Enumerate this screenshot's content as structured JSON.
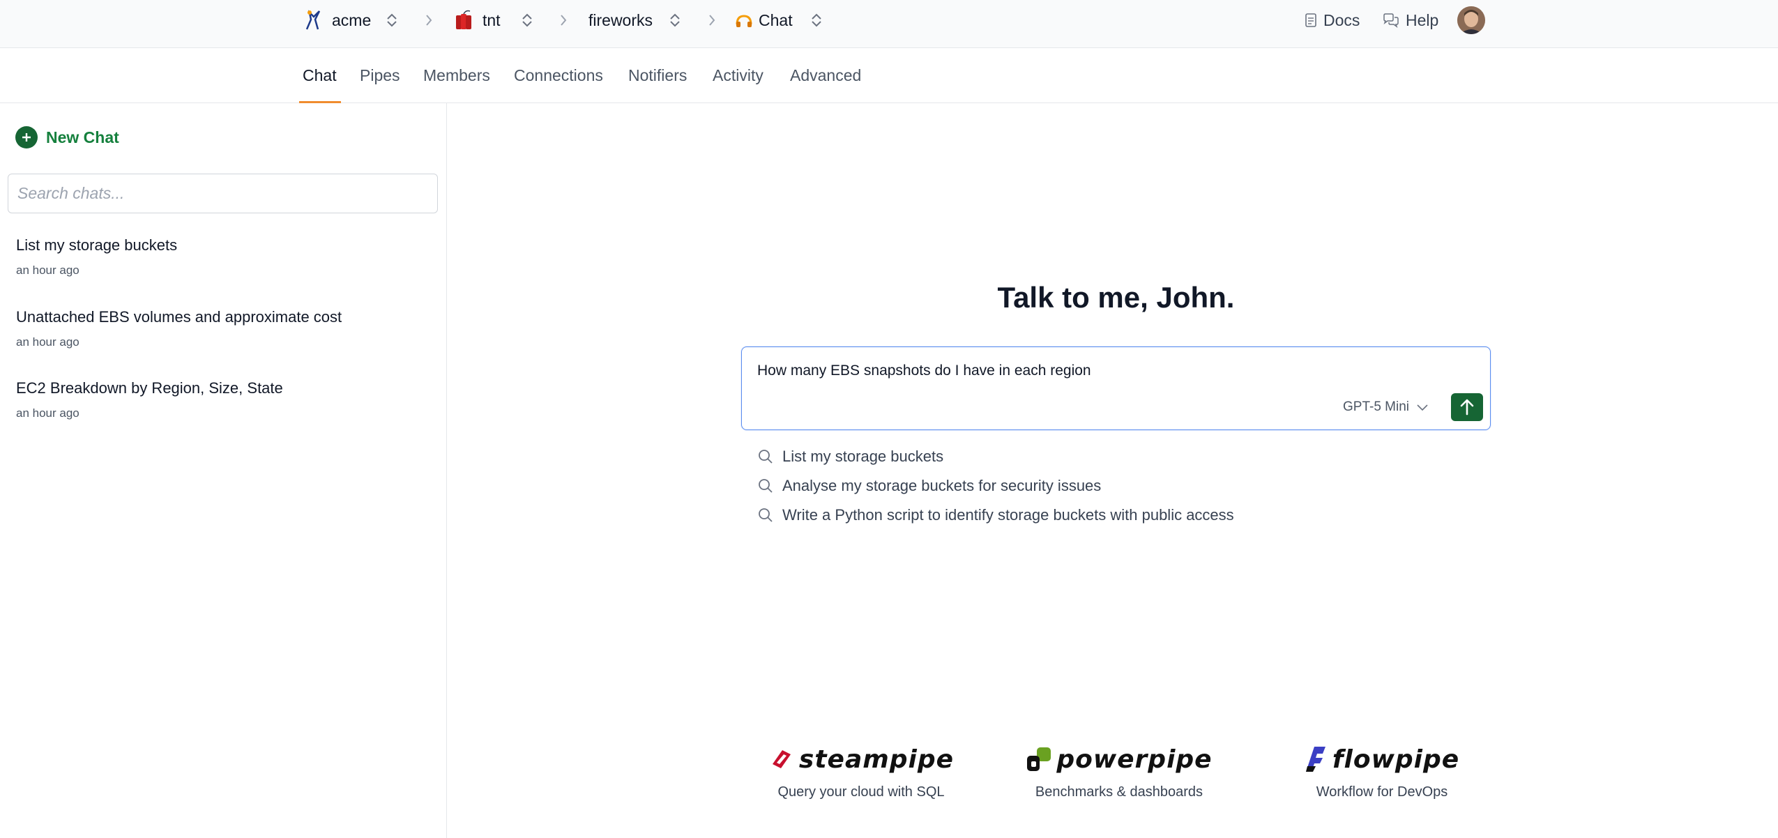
{
  "breadcrumb": {
    "org": "acme",
    "workspace": "tnt",
    "project": "fireworks",
    "section": "Chat"
  },
  "topnav": {
    "docs": "Docs",
    "help": "Help"
  },
  "tabs": [
    {
      "label": "Chat",
      "active": true
    },
    {
      "label": "Pipes"
    },
    {
      "label": "Members"
    },
    {
      "label": "Connections"
    },
    {
      "label": "Notifiers"
    },
    {
      "label": "Activity"
    },
    {
      "label": "Advanced"
    }
  ],
  "sidebar": {
    "new_chat_label": "New Chat",
    "search_placeholder": "Search chats...",
    "chats": [
      {
        "title": "List my storage buckets",
        "time": "an hour ago"
      },
      {
        "title": "Unattached EBS volumes and approximate cost",
        "time": "an hour ago"
      },
      {
        "title": "EC2 Breakdown by Region, Size, State",
        "time": "an hour ago"
      }
    ]
  },
  "main": {
    "greeting": "Talk to me, John.",
    "composer_text": "How many EBS snapshots do I have in each region",
    "model": "GPT-5 Mini",
    "suggestions": [
      "List my storage buckets",
      "Analyse my storage buckets for security issues",
      "Write a Python script to identify storage buckets with public access"
    ]
  },
  "products": [
    {
      "name": "steampipe",
      "tagline": "Query your cloud with SQL",
      "color": "#c8102e"
    },
    {
      "name": "powerpipe",
      "tagline": "Benchmarks & dashboards",
      "color": "#6aa121"
    },
    {
      "name": "flowpipe",
      "tagline": "Workflow for DevOps",
      "color": "#3b3fc4"
    }
  ],
  "colors": {
    "accent_green": "#166534",
    "tab_underline": "#f08c2e",
    "focus_border": "#5b8def"
  }
}
